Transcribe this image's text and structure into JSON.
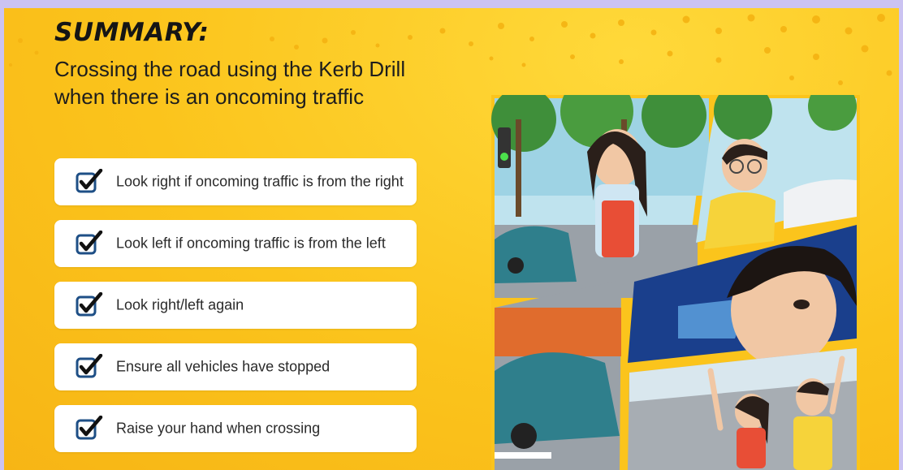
{
  "title": "SUMMARY:",
  "subtitle": "Crossing the road using the Kerb Drill when there is an oncoming traffic",
  "checklist": [
    {
      "text": "Look right if oncoming traffic is from the right",
      "checked": true
    },
    {
      "text": "Look left if oncoming traffic is from the left",
      "checked": true
    },
    {
      "text": "Look right/left again",
      "checked": true
    },
    {
      "text": "Ensure all vehicles have stopped",
      "checked": true
    },
    {
      "text": "Raise your hand when crossing",
      "checked": true
    }
  ],
  "icons": {
    "check": "checkbox-checked-icon"
  },
  "colors": {
    "background": "#fbc41c",
    "frame": "#cbc3f2",
    "checkbox": "#1e4f86",
    "card": "#ffffff"
  }
}
